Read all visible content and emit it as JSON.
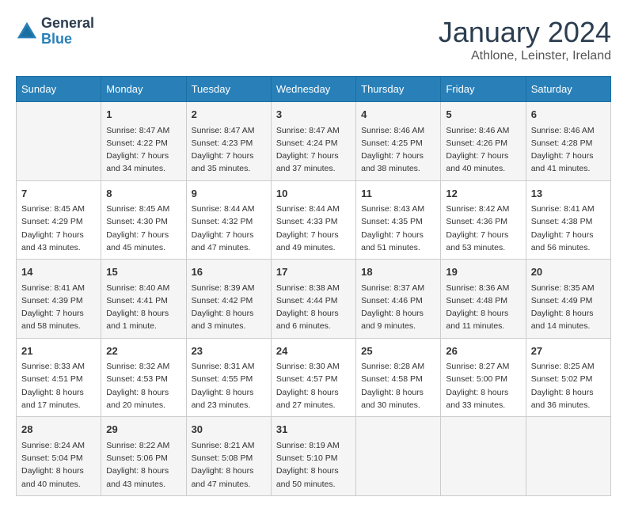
{
  "logo": {
    "general": "General",
    "blue": "Blue"
  },
  "header": {
    "month": "January 2024",
    "location": "Athlone, Leinster, Ireland"
  },
  "weekdays": [
    "Sunday",
    "Monday",
    "Tuesday",
    "Wednesday",
    "Thursday",
    "Friday",
    "Saturday"
  ],
  "weeks": [
    [
      {
        "day": "",
        "info": ""
      },
      {
        "day": "1",
        "info": "Sunrise: 8:47 AM\nSunset: 4:22 PM\nDaylight: 7 hours\nand 34 minutes."
      },
      {
        "day": "2",
        "info": "Sunrise: 8:47 AM\nSunset: 4:23 PM\nDaylight: 7 hours\nand 35 minutes."
      },
      {
        "day": "3",
        "info": "Sunrise: 8:47 AM\nSunset: 4:24 PM\nDaylight: 7 hours\nand 37 minutes."
      },
      {
        "day": "4",
        "info": "Sunrise: 8:46 AM\nSunset: 4:25 PM\nDaylight: 7 hours\nand 38 minutes."
      },
      {
        "day": "5",
        "info": "Sunrise: 8:46 AM\nSunset: 4:26 PM\nDaylight: 7 hours\nand 40 minutes."
      },
      {
        "day": "6",
        "info": "Sunrise: 8:46 AM\nSunset: 4:28 PM\nDaylight: 7 hours\nand 41 minutes."
      }
    ],
    [
      {
        "day": "7",
        "info": "Sunrise: 8:45 AM\nSunset: 4:29 PM\nDaylight: 7 hours\nand 43 minutes."
      },
      {
        "day": "8",
        "info": "Sunrise: 8:45 AM\nSunset: 4:30 PM\nDaylight: 7 hours\nand 45 minutes."
      },
      {
        "day": "9",
        "info": "Sunrise: 8:44 AM\nSunset: 4:32 PM\nDaylight: 7 hours\nand 47 minutes."
      },
      {
        "day": "10",
        "info": "Sunrise: 8:44 AM\nSunset: 4:33 PM\nDaylight: 7 hours\nand 49 minutes."
      },
      {
        "day": "11",
        "info": "Sunrise: 8:43 AM\nSunset: 4:35 PM\nDaylight: 7 hours\nand 51 minutes."
      },
      {
        "day": "12",
        "info": "Sunrise: 8:42 AM\nSunset: 4:36 PM\nDaylight: 7 hours\nand 53 minutes."
      },
      {
        "day": "13",
        "info": "Sunrise: 8:41 AM\nSunset: 4:38 PM\nDaylight: 7 hours\nand 56 minutes."
      }
    ],
    [
      {
        "day": "14",
        "info": "Sunrise: 8:41 AM\nSunset: 4:39 PM\nDaylight: 7 hours\nand 58 minutes."
      },
      {
        "day": "15",
        "info": "Sunrise: 8:40 AM\nSunset: 4:41 PM\nDaylight: 8 hours\nand 1 minute."
      },
      {
        "day": "16",
        "info": "Sunrise: 8:39 AM\nSunset: 4:42 PM\nDaylight: 8 hours\nand 3 minutes."
      },
      {
        "day": "17",
        "info": "Sunrise: 8:38 AM\nSunset: 4:44 PM\nDaylight: 8 hours\nand 6 minutes."
      },
      {
        "day": "18",
        "info": "Sunrise: 8:37 AM\nSunset: 4:46 PM\nDaylight: 8 hours\nand 9 minutes."
      },
      {
        "day": "19",
        "info": "Sunrise: 8:36 AM\nSunset: 4:48 PM\nDaylight: 8 hours\nand 11 minutes."
      },
      {
        "day": "20",
        "info": "Sunrise: 8:35 AM\nSunset: 4:49 PM\nDaylight: 8 hours\nand 14 minutes."
      }
    ],
    [
      {
        "day": "21",
        "info": "Sunrise: 8:33 AM\nSunset: 4:51 PM\nDaylight: 8 hours\nand 17 minutes."
      },
      {
        "day": "22",
        "info": "Sunrise: 8:32 AM\nSunset: 4:53 PM\nDaylight: 8 hours\nand 20 minutes."
      },
      {
        "day": "23",
        "info": "Sunrise: 8:31 AM\nSunset: 4:55 PM\nDaylight: 8 hours\nand 23 minutes."
      },
      {
        "day": "24",
        "info": "Sunrise: 8:30 AM\nSunset: 4:57 PM\nDaylight: 8 hours\nand 27 minutes."
      },
      {
        "day": "25",
        "info": "Sunrise: 8:28 AM\nSunset: 4:58 PM\nDaylight: 8 hours\nand 30 minutes."
      },
      {
        "day": "26",
        "info": "Sunrise: 8:27 AM\nSunset: 5:00 PM\nDaylight: 8 hours\nand 33 minutes."
      },
      {
        "day": "27",
        "info": "Sunrise: 8:25 AM\nSunset: 5:02 PM\nDaylight: 8 hours\nand 36 minutes."
      }
    ],
    [
      {
        "day": "28",
        "info": "Sunrise: 8:24 AM\nSunset: 5:04 PM\nDaylight: 8 hours\nand 40 minutes."
      },
      {
        "day": "29",
        "info": "Sunrise: 8:22 AM\nSunset: 5:06 PM\nDaylight: 8 hours\nand 43 minutes."
      },
      {
        "day": "30",
        "info": "Sunrise: 8:21 AM\nSunset: 5:08 PM\nDaylight: 8 hours\nand 47 minutes."
      },
      {
        "day": "31",
        "info": "Sunrise: 8:19 AM\nSunset: 5:10 PM\nDaylight: 8 hours\nand 50 minutes."
      },
      {
        "day": "",
        "info": ""
      },
      {
        "day": "",
        "info": ""
      },
      {
        "day": "",
        "info": ""
      }
    ]
  ]
}
